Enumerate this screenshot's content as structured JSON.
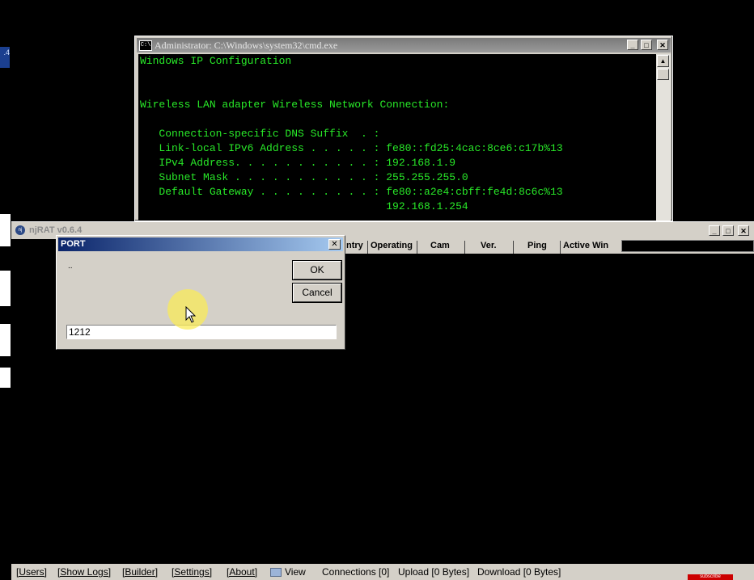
{
  "desktop": {
    "left_tab_text": ".4",
    "subscribe_text": "subscribe"
  },
  "cmd": {
    "title": "Administrator: C:\\Windows\\system32\\cmd.exe",
    "icon_text": "C:\\",
    "buttons": {
      "minimize": "_",
      "maximize": "□",
      "close": "✕"
    },
    "scroll_up": "▲",
    "lines": [
      "Windows IP Configuration",
      "",
      "",
      "Wireless LAN adapter Wireless Network Connection:",
      "",
      "   Connection-specific DNS Suffix  . :",
      "   Link-local IPv6 Address . . . . . : fe80::fd25:4cac:8ce6:c17b%13",
      "   IPv4 Address. . . . . . . . . . . : 192.168.1.9",
      "   Subnet Mask . . . . . . . . . . . : 255.255.255.0",
      "   Default Gateway . . . . . . . . . : fe80::a2e4:cbff:fe4d:8c6c%13",
      "                                       192.168.1.254"
    ],
    "text_color": "#28e828"
  },
  "njrat": {
    "title": "njRAT v0.6.4",
    "buttons": {
      "minimize": "_",
      "maximize": "□",
      "close": "✕"
    },
    "columns": [
      "ntry",
      "Operating",
      "Cam",
      "Ver.",
      "Ping",
      "Active Win"
    ],
    "status": {
      "users": "[Users]",
      "show_logs": "[Show Logs]",
      "builder": "[Builder]",
      "settings": "[Settings]",
      "about": "[About]",
      "view": "View",
      "connections": "Connections [0]",
      "upload": "Upload [0 Bytes]",
      "download": "Download [0 Bytes]"
    }
  },
  "port_dialog": {
    "title": "PORT",
    "close": "✕",
    "message": "..",
    "ok_label": "OK",
    "cancel_label": "Cancel",
    "input_value": "1212",
    "title_color_start": "#0a246a",
    "title_color_end": "#a6caf0"
  },
  "cursor": {
    "highlight_color": "#faeb5a"
  }
}
